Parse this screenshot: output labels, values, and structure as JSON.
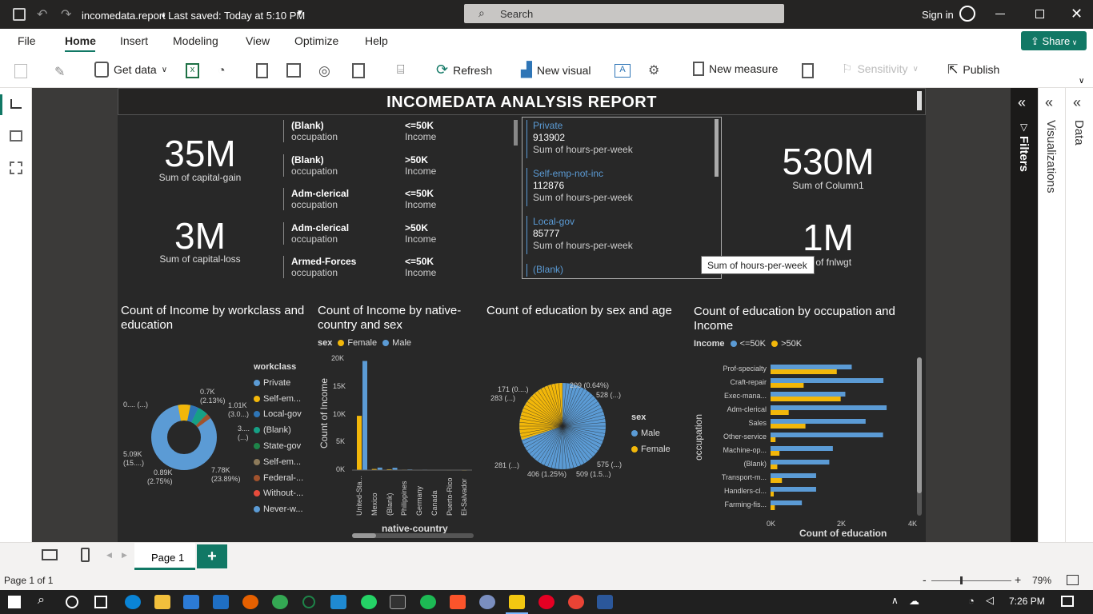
{
  "titlebar": {
    "filename": "incomedata.report",
    "saved": "• Last saved: Today at 5:10 PM",
    "search_placeholder": "Search",
    "signin": "Sign in"
  },
  "menu": {
    "items": [
      "File",
      "Home",
      "Insert",
      "Modeling",
      "View",
      "Optimize",
      "Help"
    ],
    "share": "Share"
  },
  "ribbon": {
    "get_data": "Get data",
    "refresh": "Refresh",
    "new_visual": "New visual",
    "new_measure": "New measure",
    "sensitivity": "Sensitivity",
    "publish": "Publish"
  },
  "report": {
    "title": "INCOMEDATA ANALYSIS REPORT",
    "cards": [
      {
        "value": "35M",
        "label": "Sum of capital-gain"
      },
      {
        "value": "3M",
        "label": "Sum of capital-loss"
      },
      {
        "value": "530M",
        "label": "Sum of Column1"
      },
      {
        "value": "1M",
        "label": "k of fnlwgt"
      }
    ],
    "multirow": [
      {
        "occ": "(Blank)",
        "occ_label": "occupation",
        "inc": "<=50K",
        "inc_label": "Income"
      },
      {
        "occ": "(Blank)",
        "occ_label": "occupation",
        "inc": ">50K",
        "inc_label": "Income"
      },
      {
        "occ": "Adm-clerical",
        "occ_label": "occupation",
        "inc": "<=50K",
        "inc_label": "Income"
      },
      {
        "occ": "Adm-clerical",
        "occ_label": "occupation",
        "inc": ">50K",
        "inc_label": "Income"
      },
      {
        "occ": "Armed-Forces",
        "occ_label": "occupation",
        "inc": "<=50K",
        "inc_label": "Income"
      }
    ],
    "hours_card": [
      {
        "cat": "Private",
        "val": "913902",
        "label": "Sum of hours-per-week"
      },
      {
        "cat": "Self-emp-not-inc",
        "val": "112876",
        "label": "Sum of hours-per-week"
      },
      {
        "cat": "Local-gov",
        "val": "85777",
        "label": "Sum of hours-per-week"
      },
      {
        "cat": "(Blank)"
      }
    ],
    "tooltip": "Sum of hours-per-week"
  },
  "charts": {
    "donut": {
      "title": "Count of Income by workclass and education",
      "legend_title": "workclass",
      "legend": [
        "Private",
        "Self-em...",
        "Local-gov",
        "(Blank)",
        "State-gov",
        "Self-em...",
        "Federal-...",
        "Without-...",
        "Never-w..."
      ],
      "legend_colors": [
        "#5b9bd5",
        "#f2b70a",
        "#2e75b6",
        "#16a085",
        "#1e8449",
        "#8d7b5b",
        "#a0522d",
        "#e74c3c",
        "#5b9bd5"
      ],
      "labels": [
        "0.7K",
        "(2.13%)",
        "1.01K",
        "(3.0...)",
        "3....",
        "(...)",
        "7.78K",
        "(23.89%)",
        "0.89K",
        "(2.75%)",
        "5.09K",
        "(15....)",
        "0.... (...)"
      ]
    },
    "country": {
      "title": "Count of Income by native-country and sex",
      "legend_title": "sex",
      "legend": [
        "Female",
        "Male"
      ],
      "ylabel": "Count of Income",
      "xlabel": "native-country",
      "yticks": [
        "20K",
        "15K",
        "10K",
        "5K",
        "0K"
      ],
      "categories": [
        "United-Sta...",
        "Mexico",
        "(Blank)",
        "Philippines",
        "Germany",
        "Canada",
        "Puerto-Rico",
        "El-Salvador"
      ]
    },
    "pie": {
      "title": "Count of education by sex and age",
      "legend_title": "sex",
      "legend": [
        "Male",
        "Female"
      ],
      "labels": [
        "171 (0....)",
        "283 (...)",
        "209 (0.64%)",
        "528 (...)",
        "575 (...)",
        "509 (1.5...)",
        "406 (1.25%)",
        "281 (...)"
      ]
    },
    "hbar": {
      "title": "Count of education by occupation and Income",
      "legend_title": "Income",
      "legend": [
        "<=50K",
        ">50K"
      ],
      "ylabel": "occupation",
      "xlabel": "Count of education",
      "xticks": [
        "0K",
        "2K",
        "4K"
      ],
      "categories": [
        "Prof-specialty",
        "Craft-repair",
        "Exec-mana...",
        "Adm-clerical",
        "Sales",
        "Other-service",
        "Machine-op...",
        "(Blank)",
        "Transport-m...",
        "Handlers-cl...",
        "Farming-fis..."
      ]
    }
  },
  "chart_data": [
    {
      "type": "bar",
      "title": "Count of Income by native-country and sex",
      "categories": [
        "United-Sta...",
        "Mexico",
        "(Blank)",
        "Philippines",
        "Germany",
        "Canada",
        "Puerto-Rico",
        "El-Salvador"
      ],
      "series": [
        {
          "name": "Female",
          "values": [
            9700,
            200,
            150,
            80,
            60,
            50,
            40,
            30
          ]
        },
        {
          "name": "Male",
          "values": [
            19500,
            450,
            420,
            120,
            80,
            70,
            70,
            70
          ]
        }
      ],
      "ylim": [
        0,
        20000
      ],
      "xlabel": "native-country",
      "ylabel": "Count of Income"
    },
    {
      "type": "bar",
      "title": "Count of education by occupation and Income",
      "categories": [
        "Prof-specialty",
        "Craft-repair",
        "Exec-mana...",
        "Adm-clerical",
        "Sales",
        "Other-service",
        "Machine-op...",
        "(Blank)",
        "Transport-m...",
        "Handlers-cl...",
        "Farming-fis..."
      ],
      "series": [
        {
          "name": "<=50K",
          "values": [
            2280,
            3170,
            2100,
            3260,
            2670,
            3160,
            1750,
            1650,
            1280,
            1280,
            880
          ]
        },
        {
          "name": ">50K",
          "values": [
            1860,
            930,
            1970,
            510,
            980,
            140,
            250,
            190,
            320,
            90,
            120
          ]
        }
      ],
      "xlim": [
        0,
        4000
      ],
      "xlabel": "Count of education",
      "ylabel": "occupation"
    }
  ],
  "pages": {
    "tab": "Page 1",
    "add": "+"
  },
  "status": {
    "page": "Page 1 of 1",
    "zoom": "79%"
  },
  "taskbar": {
    "time": "7:26 PM"
  }
}
